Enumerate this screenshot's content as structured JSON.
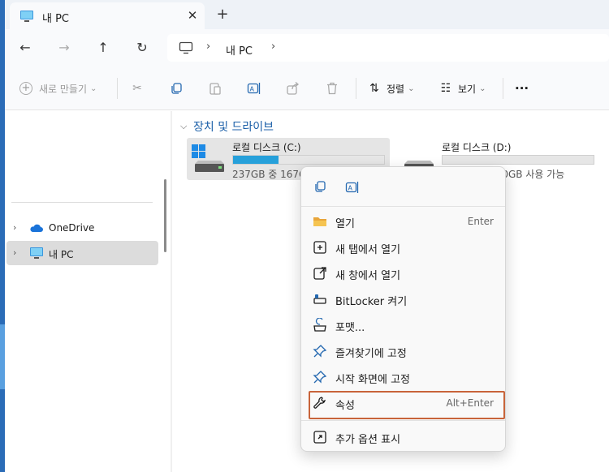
{
  "window": {
    "tab_title": "내 PC",
    "tab_close_glyph": "✕",
    "new_tab_glyph": "+"
  },
  "nav": {
    "back_glyph": "←",
    "forward_glyph": "→",
    "up_glyph": "↑",
    "refresh_glyph": "↻"
  },
  "address": {
    "segment": "내 PC",
    "chevron": "›"
  },
  "toolbar": {
    "new_label": "새로 만들기",
    "sort_label": "정렬",
    "view_label": "보기",
    "more_label": "···",
    "dropdown_glyph": "⌄"
  },
  "sidebar": {
    "items": [
      {
        "label": "OneDrive",
        "chevron": "›",
        "icon": "cloud-icon"
      },
      {
        "label": "내 PC",
        "chevron": "›",
        "icon": "pc-icon"
      }
    ]
  },
  "content": {
    "group_title": "장치 및 드라이브",
    "group_chevron": "⌵",
    "drives": [
      {
        "label": "로컬 디스크 (C:)",
        "space": "237GB 중 167GB 사용 가능",
        "used_fraction": 0.3,
        "icon": "windows-drive-icon"
      },
      {
        "label": "로컬 디스크 (D:)",
        "space": "931GB 중 930GB 사용 가능",
        "used_fraction": 0.0,
        "icon": "drive-icon"
      }
    ]
  },
  "context_menu": {
    "quick_actions": [
      "copy-icon",
      "rename-icon"
    ],
    "items": [
      {
        "label": "열기",
        "accel": "Enter",
        "icon": "folder-open-icon"
      },
      {
        "label": "새 탭에서 열기",
        "accel": "",
        "icon": "new-tab-icon"
      },
      {
        "label": "새 창에서 열기",
        "accel": "",
        "icon": "new-window-icon"
      },
      {
        "label": "BitLocker 켜기",
        "accel": "",
        "icon": "key-icon"
      },
      {
        "label": "포맷...",
        "accel": "",
        "icon": "format-icon"
      },
      {
        "label": "즐겨찾기에 고정",
        "accel": "",
        "icon": "pin-icon"
      },
      {
        "label": "시작 화면에 고정",
        "accel": "",
        "icon": "pin-start-icon"
      },
      {
        "label": "속성",
        "accel": "Alt+Enter",
        "icon": "wrench-icon"
      },
      {
        "label": "추가 옵션 표시",
        "accel": "",
        "icon": "more-options-icon"
      }
    ]
  },
  "colors": {
    "accent": "#26a0da",
    "highlight_border": "#c8643a"
  }
}
